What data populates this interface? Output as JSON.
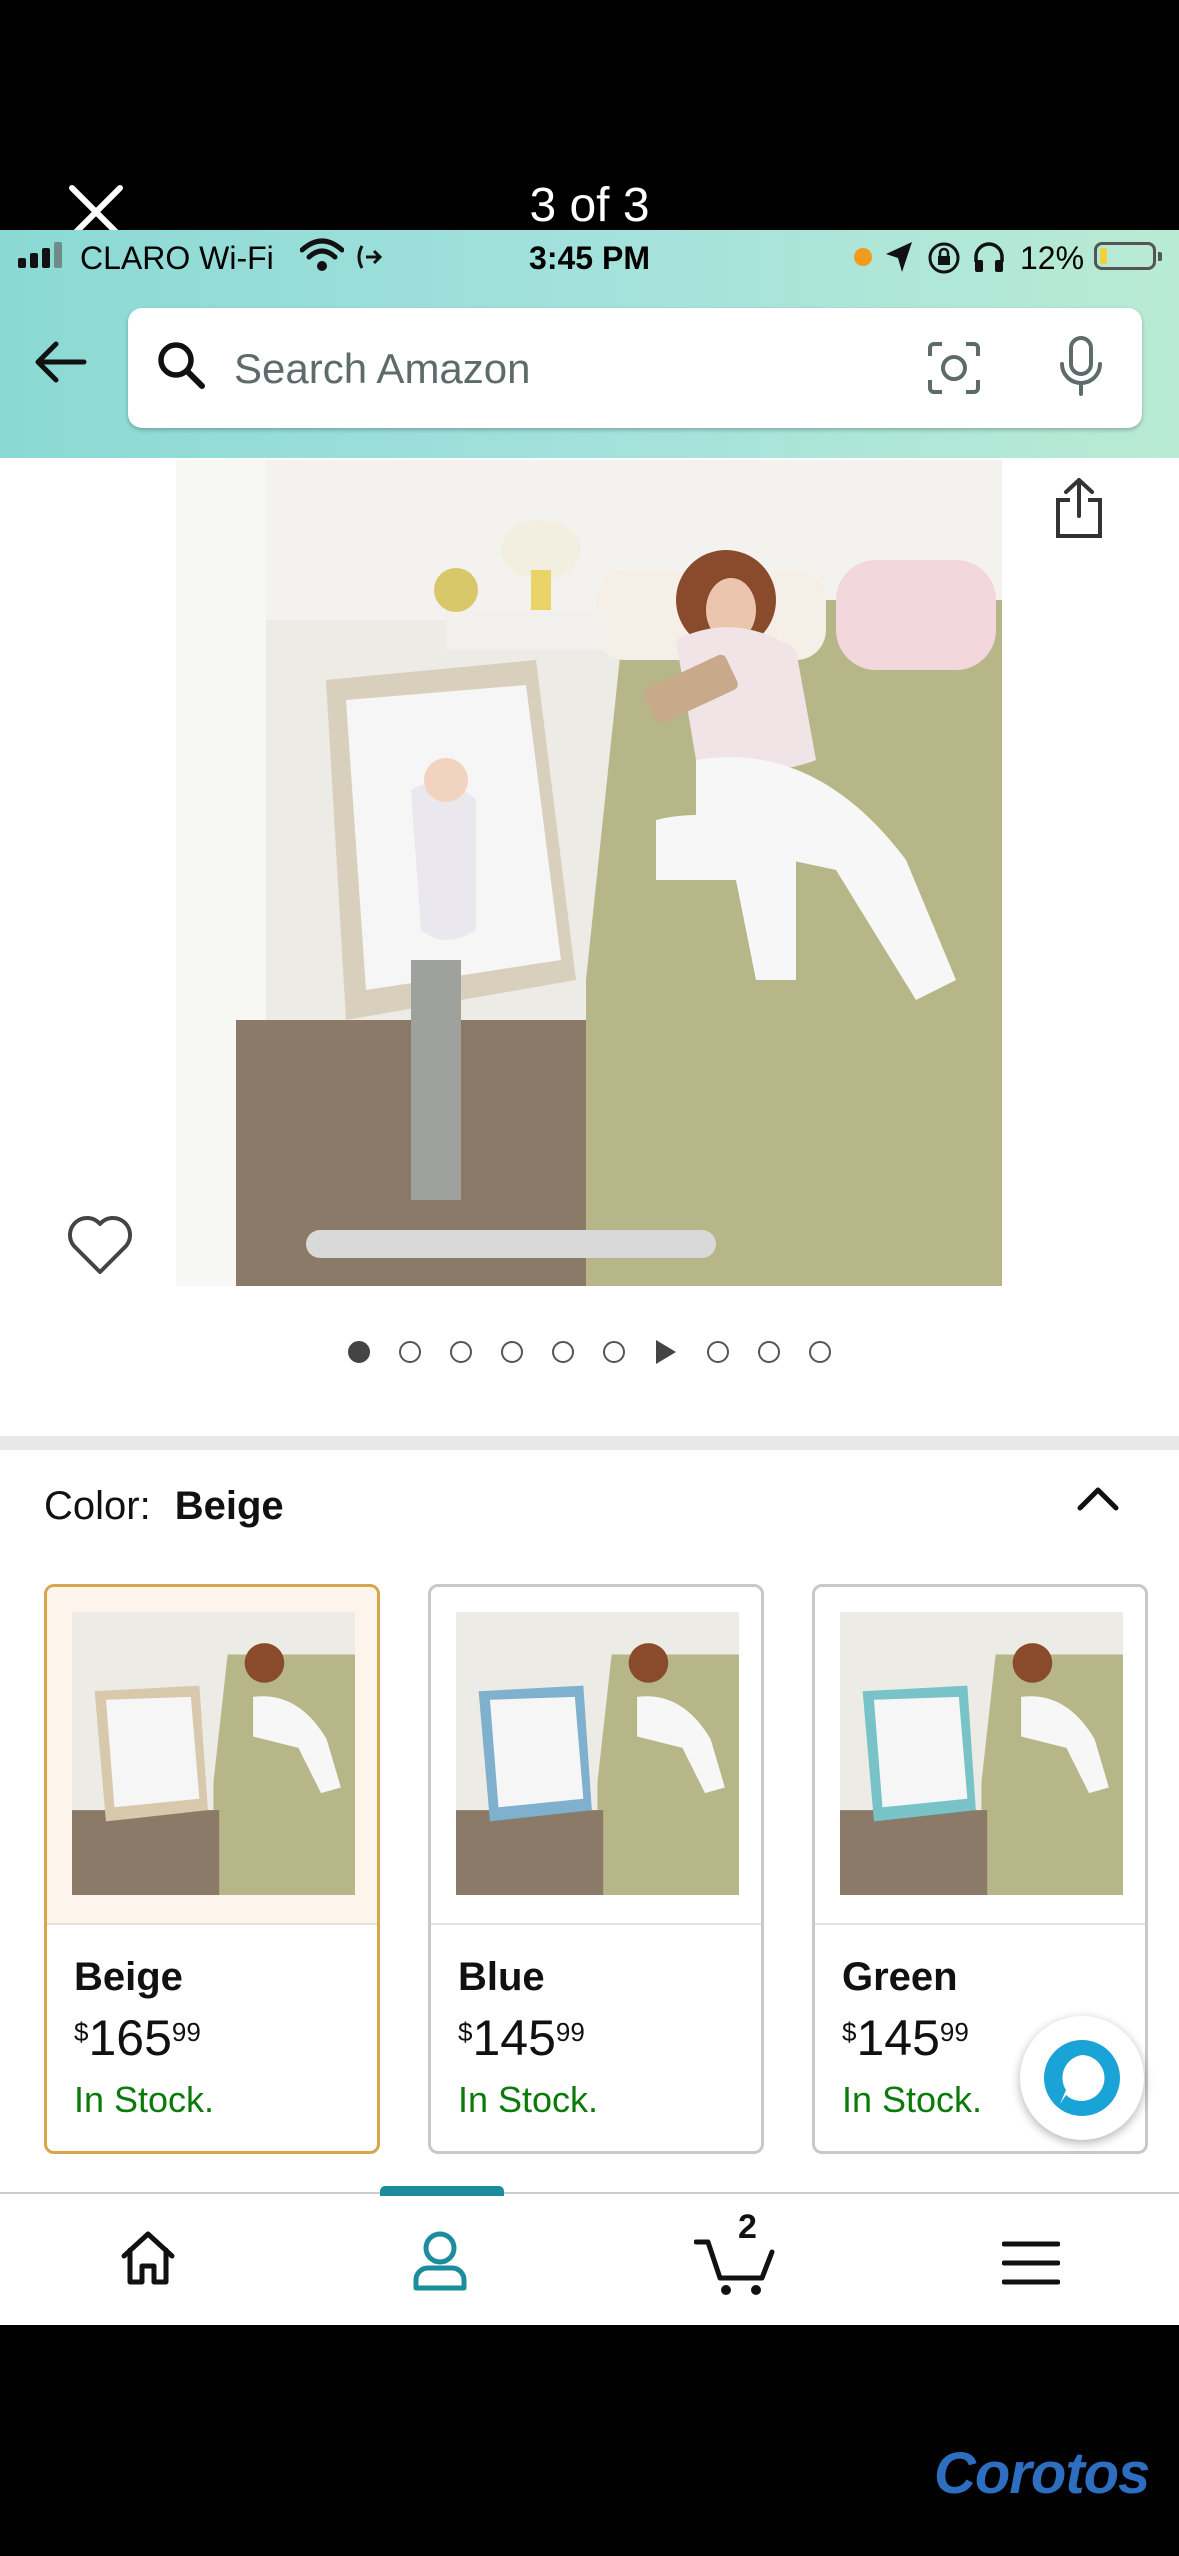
{
  "viewer": {
    "counter": "3 of 3",
    "close_icon": "close-icon",
    "watermark": "Corotos"
  },
  "status_bar": {
    "carrier": "CLARO Wi-Fi",
    "time": "3:45 PM",
    "battery_percent": "12%",
    "battery_level": 0.12,
    "colors": {
      "orange_dot": "#f29a1d",
      "battery_fill": "#f2d23a"
    }
  },
  "search": {
    "placeholder": "Search Amazon",
    "icons": [
      "back-arrow-icon",
      "search-icon",
      "camera-scan-icon",
      "microphone-icon"
    ]
  },
  "gallery": {
    "dot_count": 10,
    "active_index": 0,
    "video_index": 6,
    "icons": [
      "share-icon",
      "heart-icon"
    ]
  },
  "color_picker": {
    "label": "Color:",
    "selected": "Beige",
    "options": [
      {
        "name": "Beige",
        "currency": "$",
        "whole": "165",
        "fraction": "99",
        "stock": "In Stock.",
        "frame_color": "#d8c8ac",
        "selected": true
      },
      {
        "name": "Blue",
        "currency": "$",
        "whole": "145",
        "fraction": "99",
        "stock": "In Stock.",
        "frame_color": "#7fb0cd",
        "selected": false
      },
      {
        "name": "Green",
        "currency": "$",
        "whole": "145",
        "fraction": "99",
        "stock": "In Stock.",
        "frame_color": "#78c3c8",
        "selected": false
      }
    ],
    "colors": {
      "in_stock": "#0b7a0b",
      "selected_border": "#d9a54a"
    }
  },
  "bottom_nav": {
    "items": [
      "home-icon",
      "account-icon",
      "cart-icon",
      "menu-icon"
    ],
    "cart_count": "2",
    "active_item": "account-icon",
    "accent": "#1a8c9b"
  }
}
